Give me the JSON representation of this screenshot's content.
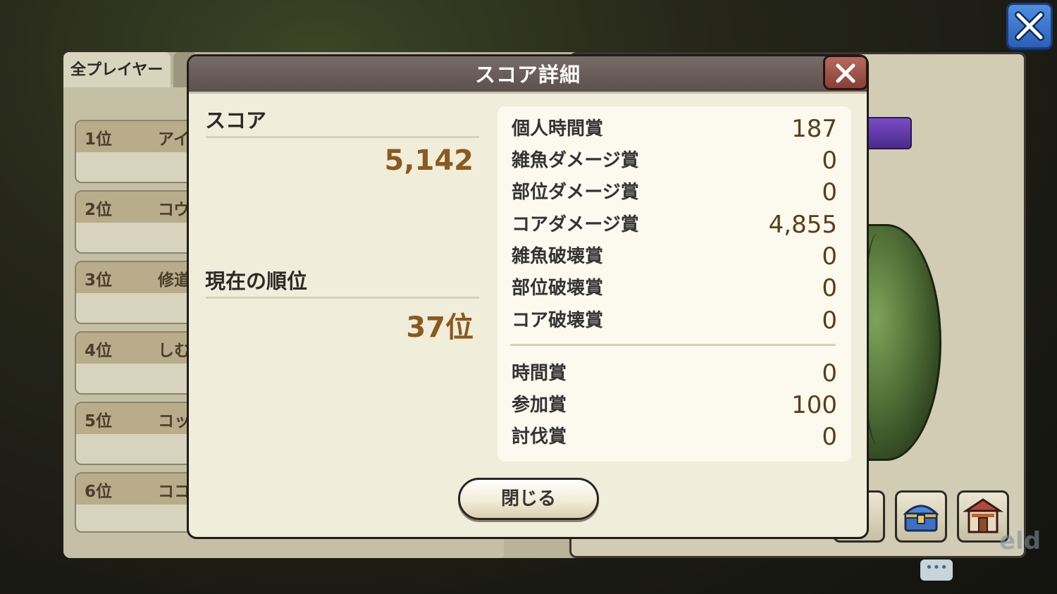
{
  "ranking": {
    "tab_label": "全プレイヤー",
    "rows": [
      {
        "rank": "1位",
        "name": "アイ"
      },
      {
        "rank": "2位",
        "name": "コウ"
      },
      {
        "rank": "3位",
        "name": "修道"
      },
      {
        "rank": "4位",
        "name": "しむ"
      },
      {
        "rank": "5位",
        "name": "コッ"
      },
      {
        "rank": "6位",
        "name": "ココ"
      }
    ]
  },
  "modal": {
    "title": "スコア詳細",
    "score_label": "スコア",
    "score_value": "5,142",
    "rank_label": "現在の順位",
    "rank_value": "37位",
    "bonuses": [
      {
        "label": "個人時間賞",
        "value": "187"
      },
      {
        "label": "雑魚ダメージ賞",
        "value": "0"
      },
      {
        "label": "部位ダメージ賞",
        "value": "0"
      },
      {
        "label": "コアダメージ賞",
        "value": "4,855"
      },
      {
        "label": "雑魚破壊賞",
        "value": "0"
      },
      {
        "label": "部位破壊賞",
        "value": "0"
      },
      {
        "label": "コア破壊賞",
        "value": "0"
      }
    ],
    "extra_bonuses": [
      {
        "label": "時間賞",
        "value": "0"
      },
      {
        "label": "参加賞",
        "value": "100"
      },
      {
        "label": "討伐賞",
        "value": "0"
      }
    ],
    "close_label": "閉じる"
  },
  "icons": {
    "top_close": "close-icon",
    "modal_close": "close-icon",
    "treasure": "treasure-chest-icon",
    "shop": "shop-icon",
    "chat": "chat-bubble-icon"
  },
  "watermark": "eld",
  "colors": {
    "modal_header": "#6b5f5c",
    "value_brown": "#8a5a1e",
    "top_close_blue": "#3f7bd3"
  }
}
